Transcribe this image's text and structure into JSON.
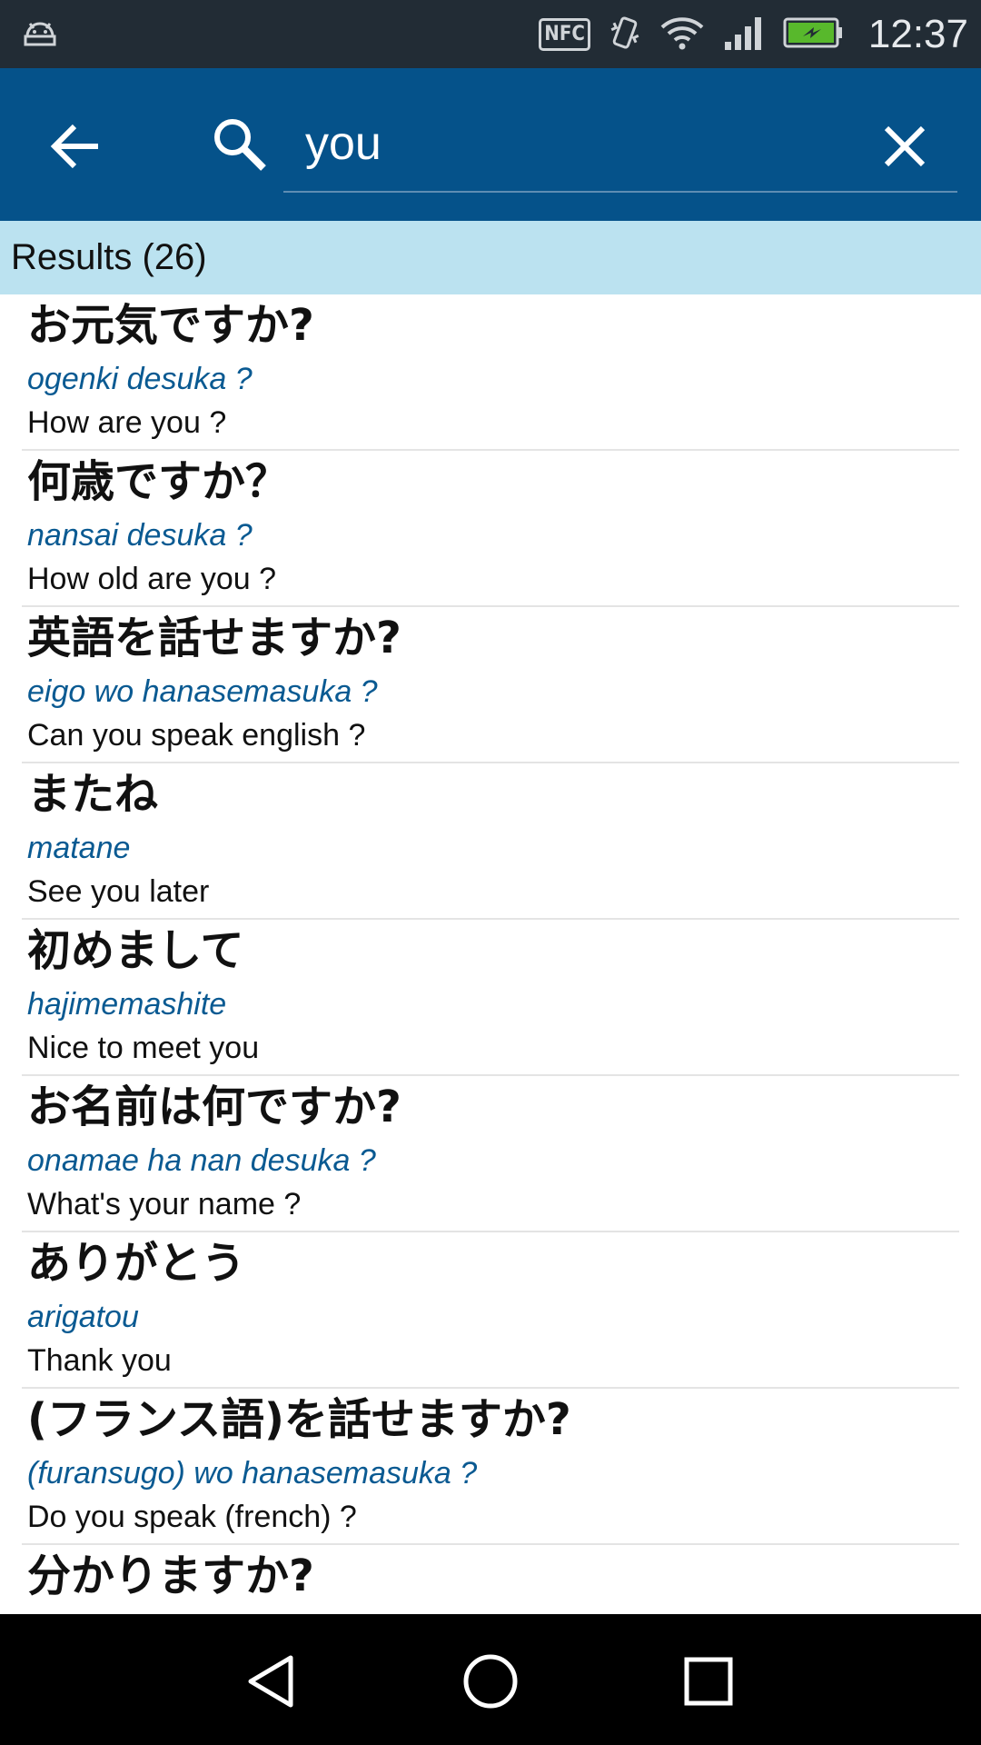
{
  "status_bar": {
    "nfc_label": "NFC",
    "time": "12:37",
    "icons": [
      "android-icon",
      "nfc-icon",
      "vibrate-icon",
      "wifi-icon",
      "signal-icon",
      "battery-charging-icon"
    ]
  },
  "app_bar": {
    "back_icon": "arrow-left-icon",
    "search_icon": "search-icon",
    "search_value": "you",
    "clear_icon": "close-icon"
  },
  "results": {
    "header": "Results (26)",
    "items": [
      {
        "japanese": "お元気ですか?",
        "romaji": "ogenki desuka ?",
        "english": "How are you ?"
      },
      {
        "japanese": "何歳ですか？",
        "romaji": "nansai desuka ?",
        "english": "How old are you ?"
      },
      {
        "japanese": "英語を話せますか?",
        "romaji": "eigo wo hanasemasuka ?",
        "english": "Can you speak english ?"
      },
      {
        "japanese": "またね",
        "romaji": "matane",
        "english": "See you later"
      },
      {
        "japanese": "初めまして",
        "romaji": "hajimemashite",
        "english": "Nice to meet you"
      },
      {
        "japanese": "お名前は何ですか?",
        "romaji": "onamae ha nan desuka ?",
        "english": "What's your name ?"
      },
      {
        "japanese": "ありがとう",
        "romaji": "arigatou",
        "english": "Thank you"
      },
      {
        "japanese": "(フランス語)を話せますか?",
        "romaji": "(furansugo) wo hanasemasuka ?",
        "english": "Do you speak (french) ?"
      },
      {
        "japanese": "分かりますか?",
        "romaji": "",
        "english": ""
      }
    ]
  },
  "colors": {
    "status_bar": "#222c35",
    "app_bar": "#05528a",
    "results_header": "#bbe2f0",
    "romaji": "#0a5a92",
    "nav_bar": "#000000"
  },
  "nav_bar": {
    "icons": [
      "back-triangle-icon",
      "home-circle-icon",
      "recents-square-icon"
    ]
  }
}
